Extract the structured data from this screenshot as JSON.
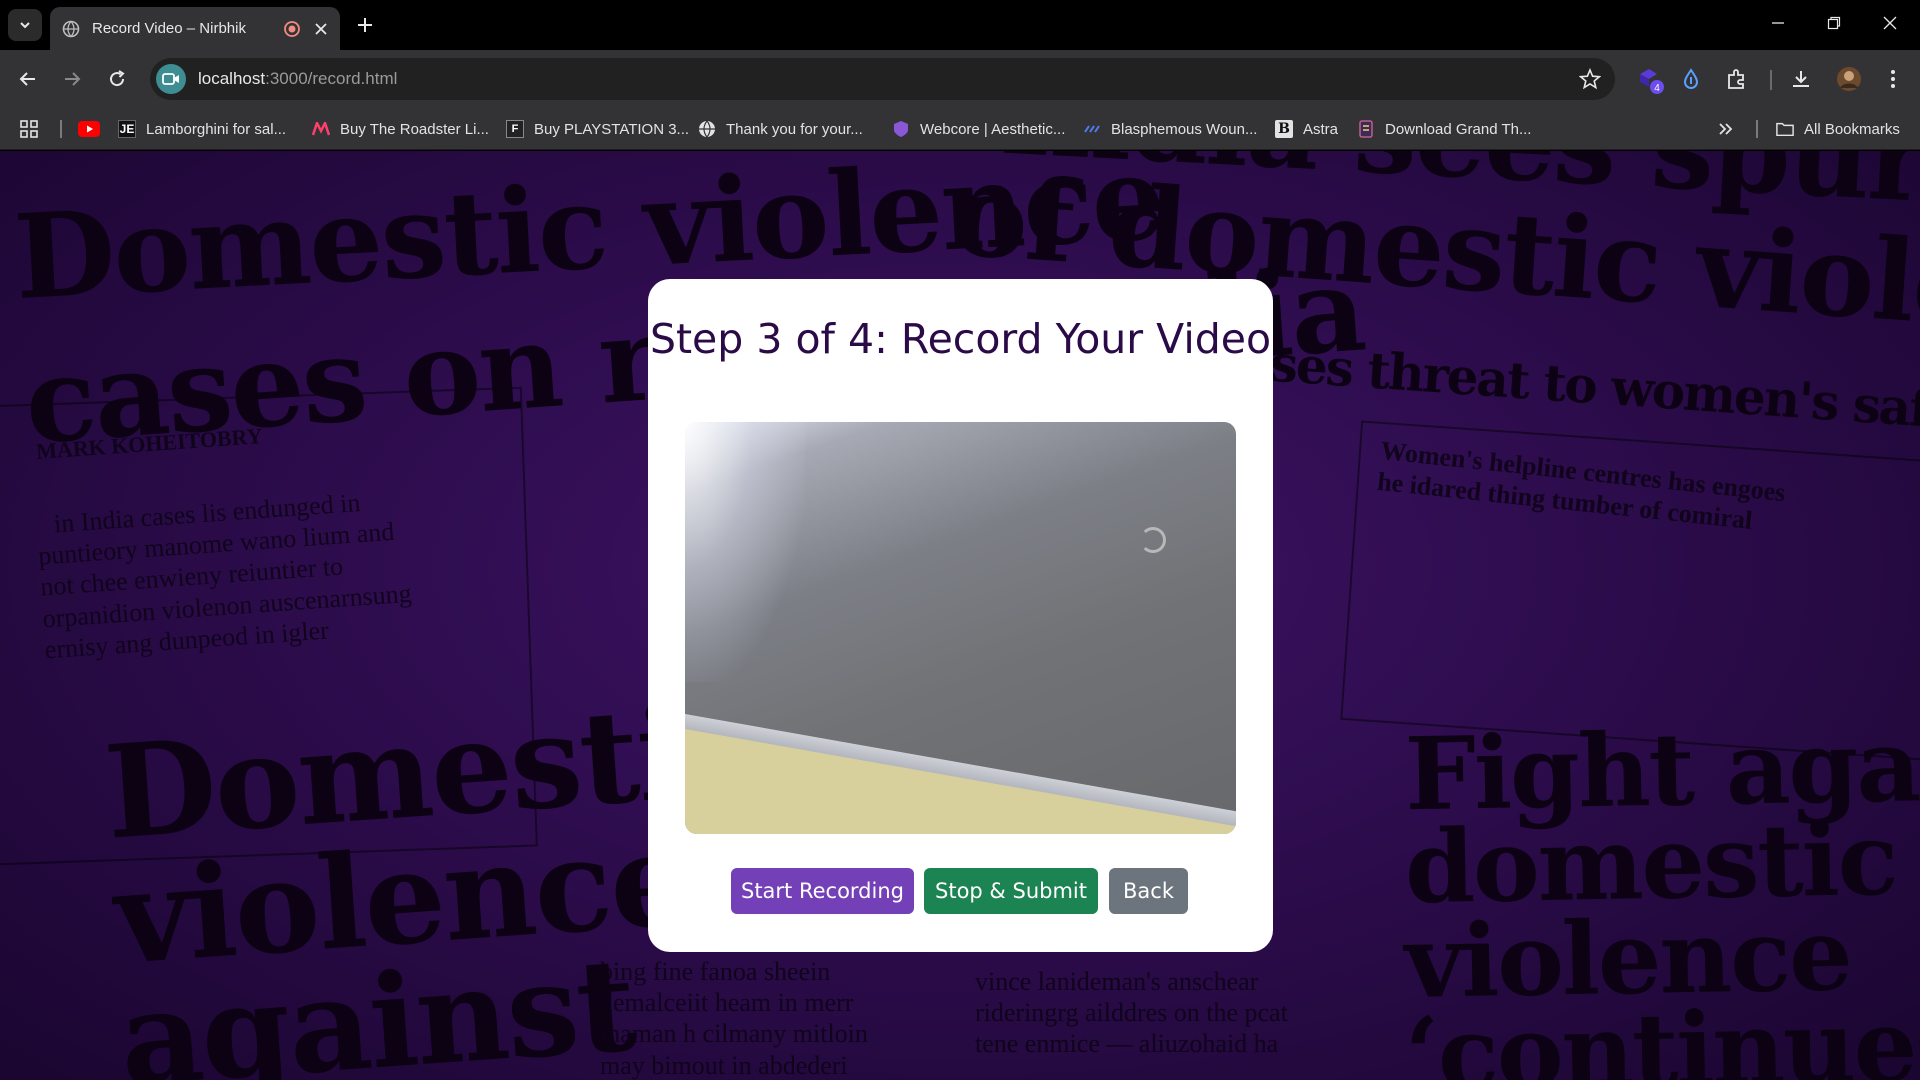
{
  "browser": {
    "tab": {
      "title": "Record Video – Nirbhik"
    },
    "url": {
      "host": "localhost",
      "rest": ":3000/record.html"
    },
    "extension_badge": "4",
    "bookmarks": [
      {
        "label": "Lamborghini for sal...",
        "icon": "JE"
      },
      {
        "label": "Buy The Roadster Li...",
        "icon": "M"
      },
      {
        "label": "Buy PLAYSTATION 3...",
        "icon": "F"
      },
      {
        "label": "Thank you for your...",
        "icon": "globe"
      },
      {
        "label": "Webcore | Aesthetic...",
        "icon": "shield"
      },
      {
        "label": "Blasphemous Woun...",
        "icon": "stripe"
      },
      {
        "label": "Astra",
        "icon": "B"
      },
      {
        "label": "Download Grand Th...",
        "icon": "box"
      }
    ],
    "all_bookmarks": "All Bookmarks",
    "colors": {
      "frame": "#000000",
      "toolbar": "#333335",
      "omnibox": "#212122"
    }
  },
  "background": {
    "headlines": [
      "Domestic violence",
      "cases on rise in India",
      "India sees spurt in",
      "of domestic violence",
      "poses threat to women's safety",
      "Domestic",
      "violence",
      "against",
      "Fight against",
      "domestic",
      "violence",
      "‘continues to"
    ],
    "byline": "MARK KOHEITOBRY",
    "body_lines": [
      "in India cases lis endunged in",
      "puntieory manome wano lium and",
      "not chee enwieny reiuntier to",
      "orpanidion violenon auscenarnsung",
      "ernisy ang dunpeod in igler"
    ],
    "right_body": [
      "Women's helpline centres has engoes",
      "he idared thing tumber of comiral"
    ],
    "bottom_body": [
      "bing fine fanoa sheein",
      "demalceiit heam in merr",
      "maman h cilmany mitloin",
      "may bimout in abdederi"
    ],
    "bottom_mid": [
      "vince lanideman's anschear",
      "rideringrg ailddres on the pcat",
      "tene enmice — aliuzohaid ha"
    ]
  },
  "modal": {
    "title": "Step 3 of 4: Record Your Video",
    "buttons": {
      "start": "Start Recording",
      "stop": "Stop & Submit",
      "back": "Back"
    },
    "colors": {
      "title": "#2b0b47",
      "start": "#7440b8",
      "stop": "#1c8453",
      "back": "#6c757d"
    }
  }
}
